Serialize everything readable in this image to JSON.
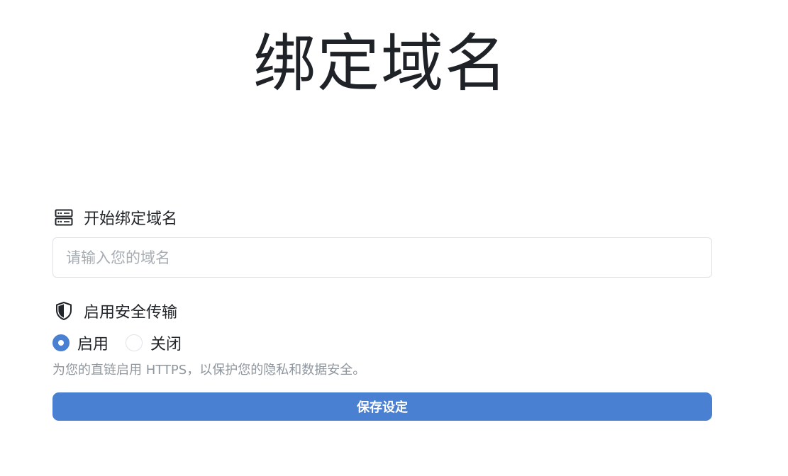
{
  "page": {
    "title": "绑定域名"
  },
  "domain_section": {
    "label": "开始绑定域名",
    "icon": "server-icon",
    "input": {
      "value": "",
      "placeholder": "请输入您的域名"
    }
  },
  "https_section": {
    "label": "启用安全传输",
    "icon": "shield-icon",
    "options": [
      {
        "label": "启用",
        "selected": true
      },
      {
        "label": "关闭",
        "selected": false
      }
    ],
    "help_text": "为您的直链启用 HTTPS，以保护您的隐私和数据安全。"
  },
  "actions": {
    "save_label": "保存设定"
  },
  "colors": {
    "accent": "#4a80d2",
    "text": "#212529",
    "muted": "#8f969d",
    "border": "#dee2e6"
  }
}
